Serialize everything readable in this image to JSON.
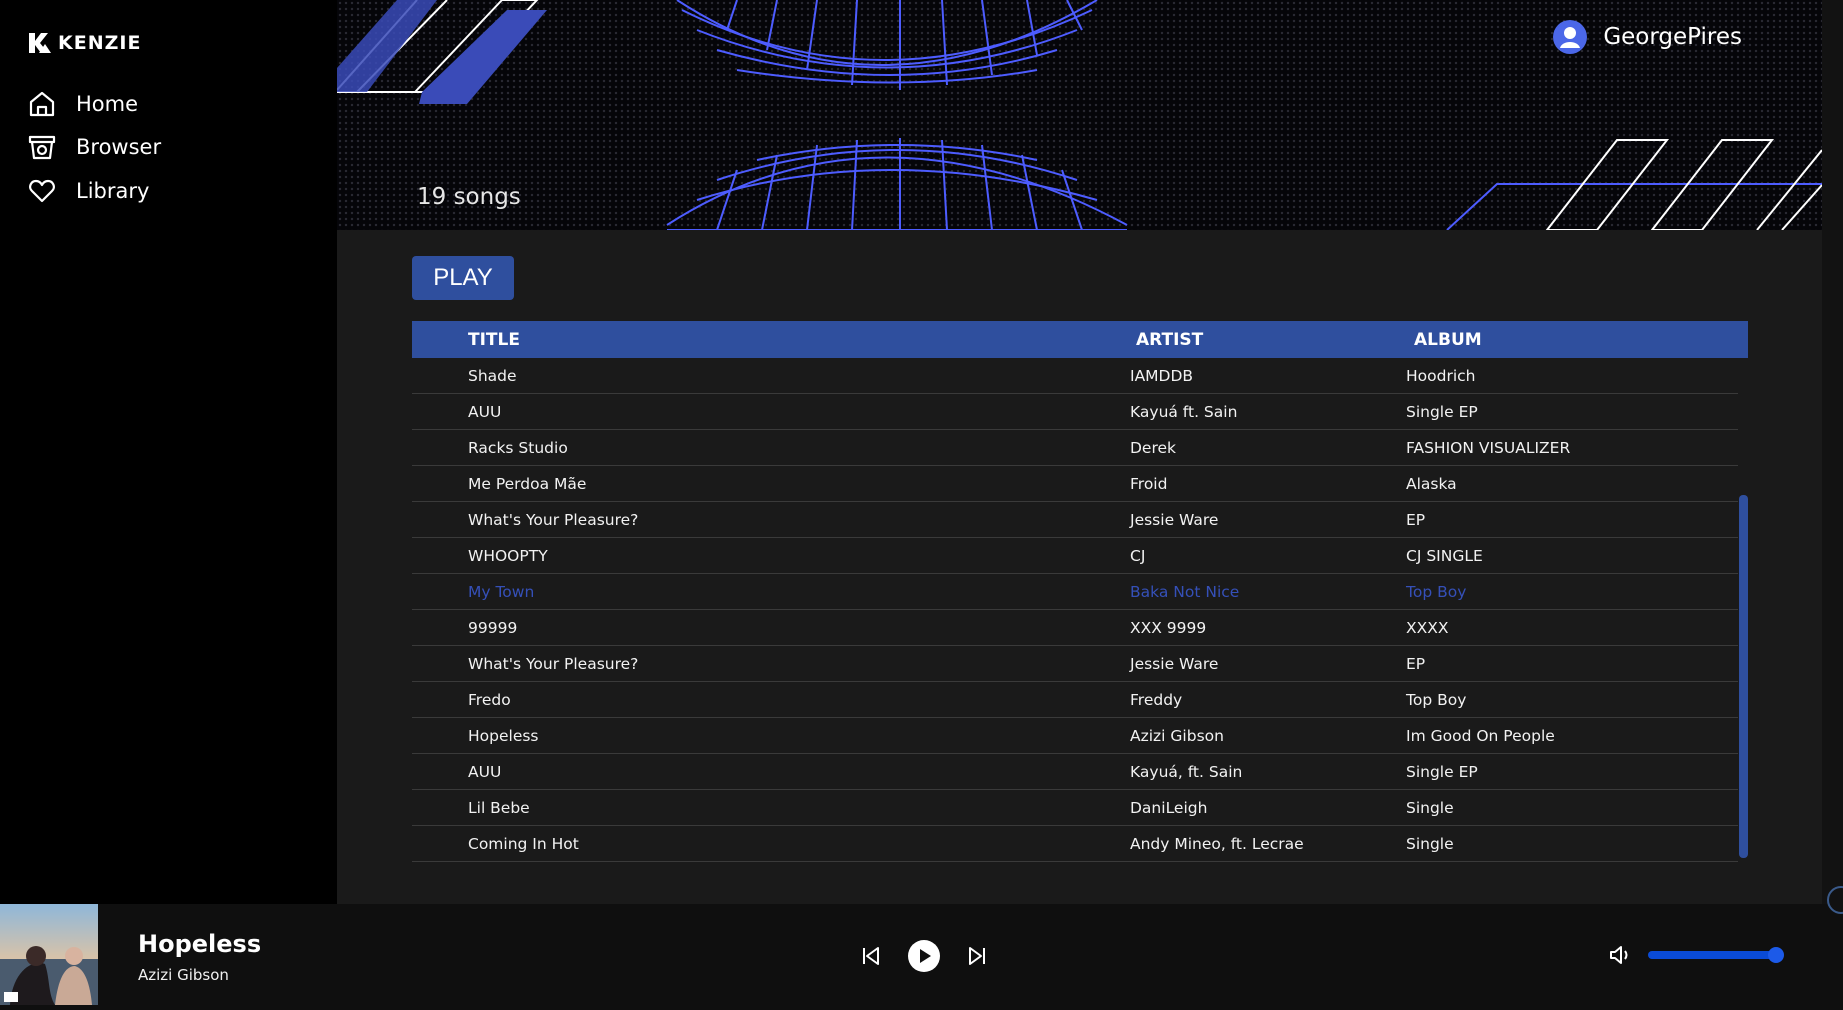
{
  "app": {
    "logo_text": "KENZIE"
  },
  "sidebar": {
    "items": [
      {
        "label": "Home",
        "icon": "home-icon"
      },
      {
        "label": "Browser",
        "icon": "basket-icon"
      },
      {
        "label": "Library",
        "icon": "heart-icon"
      }
    ]
  },
  "header": {
    "songs_count": "19 songs",
    "username": "GeorgePires"
  },
  "main": {
    "play_label": "PLAY",
    "columns": {
      "title": "TITLE",
      "artist": "ARTIST",
      "album": "ALBUM"
    },
    "rows": [
      {
        "title": "Shade",
        "artist": "IAMDDB",
        "album": "Hoodrich",
        "active": false
      },
      {
        "title": "AUU",
        "artist": "Kayuá ft. Sain",
        "album": "Single EP",
        "active": false
      },
      {
        "title": "Racks Studio",
        "artist": "Derek",
        "album": "FASHION VISUALIZER",
        "active": false
      },
      {
        "title": "Me Perdoa Mãe",
        "artist": "Froid",
        "album": "Alaska",
        "active": false
      },
      {
        "title": "What's Your Pleasure?",
        "artist": "Jessie Ware",
        "album": "EP",
        "active": false
      },
      {
        "title": "WHOOPTY",
        "artist": "CJ",
        "album": "CJ SINGLE",
        "active": false
      },
      {
        "title": "My Town",
        "artist": "Baka Not Nice",
        "album": "Top Boy",
        "active": true
      },
      {
        "title": "99999",
        "artist": "XXX 9999",
        "album": "XXXX",
        "active": false
      },
      {
        "title": "What's Your Pleasure?",
        "artist": "Jessie Ware",
        "album": "EP",
        "active": false
      },
      {
        "title": "Fredo",
        "artist": "Freddy",
        "album": "Top Boy",
        "active": false
      },
      {
        "title": "Hopeless",
        "artist": "Azizi Gibson",
        "album": "Im Good On People",
        "active": false
      },
      {
        "title": "AUU",
        "artist": "Kayuá, ft. Sain",
        "album": "Single EP",
        "active": false
      },
      {
        "title": "Lil Bebe",
        "artist": "DaniLeigh",
        "album": "Single",
        "active": false
      },
      {
        "title": "Coming In Hot",
        "artist": "Andy Mineo, ft. Lecrae",
        "album": "Single",
        "active": false
      }
    ]
  },
  "player": {
    "title": "Hopeless",
    "artist": "Azizi Gibson",
    "volume": 1.0
  },
  "colors": {
    "accent": "#2f4f9e",
    "active_text": "#3550b8",
    "grid_lines": "#3d5cff"
  }
}
